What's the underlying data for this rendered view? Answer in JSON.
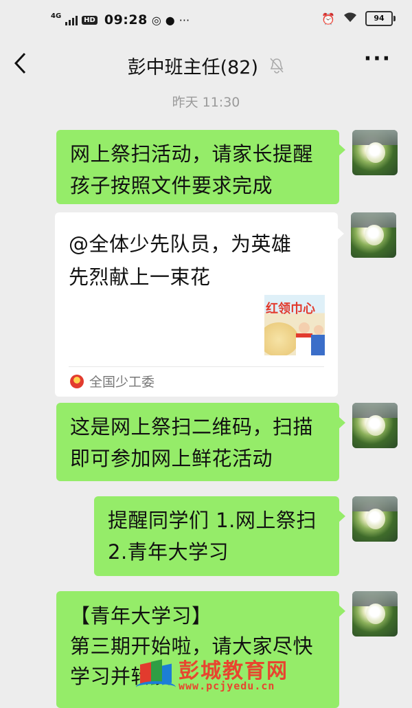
{
  "status_bar": {
    "network": "4G",
    "hd": "HD",
    "time": "09:28",
    "battery": "94",
    "icons": [
      "signal-icon",
      "hd-icon",
      "app-notification-icon",
      "chat-notification-icon",
      "more-dots-icon",
      "alarm-icon",
      "wifi-icon",
      "battery-icon"
    ]
  },
  "header": {
    "title": "彭中班主任(82)",
    "icons": [
      "back-icon",
      "mute-bell-icon",
      "more-icon"
    ]
  },
  "timestamp": "昨天 11:30",
  "messages": [
    {
      "type": "text",
      "lines": [
        "网上祭扫活动，请家长提醒",
        "孩子按照文件要求完成"
      ]
    },
    {
      "type": "link_card",
      "lines": [
        "@全体少先队员，为英雄",
        "先烈献上一束花"
      ],
      "thumbnail_text": "红领巾心",
      "source": "全国少工委"
    },
    {
      "type": "text",
      "lines": [
        "这是网上祭扫二维码，扫描",
        "即可参加网上鲜花活动"
      ]
    },
    {
      "type": "text",
      "lines": [
        "提醒同学们 1.网上祭扫",
        "2.青年大学习"
      ]
    },
    {
      "type": "text",
      "lines": [
        "【青年大学习】",
        "第三期开始啦，请大家尽快",
        "学习并转发"
      ]
    }
  ],
  "watermark": {
    "name": "彭城教育网",
    "url": "www.pcjyedu.cn"
  },
  "colors": {
    "background": "#ededed",
    "sent_bubble": "#95ec69",
    "card": "#ffffff",
    "watermark": "#e8452f"
  }
}
